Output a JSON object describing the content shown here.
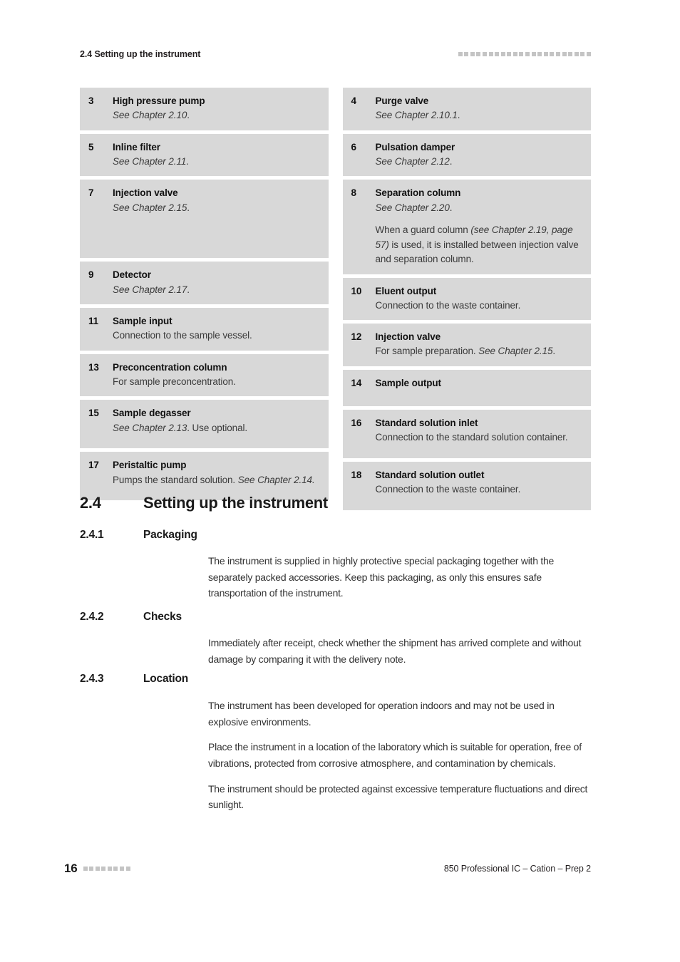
{
  "header": {
    "title": "2.4 Setting up the instrument",
    "rule_square_count": 22,
    "rule_color": "#c4c4c4"
  },
  "component_table": {
    "background_color": "#d8d8d8",
    "left_column": [
      {
        "number": "3",
        "title": "High pressure pump",
        "lines": [
          [
            {
              "text": "See Chapter 2.10",
              "style": "italic"
            },
            {
              "text": ".",
              "style": "normal"
            }
          ]
        ]
      },
      {
        "number": "5",
        "title": "Inline filter",
        "lines": [
          [
            {
              "text": "See Chapter 2.11",
              "style": "italic"
            },
            {
              "text": ".",
              "style": "normal"
            }
          ]
        ]
      },
      {
        "number": "7",
        "title": "Injection valve",
        "lines": [
          [
            {
              "text": "See Chapter 2.15",
              "style": "italic"
            },
            {
              "text": ".",
              "style": "normal"
            }
          ]
        ]
      },
      {
        "number": "9",
        "title": "Detector",
        "lines": [
          [
            {
              "text": "See Chapter 2.17",
              "style": "italic"
            },
            {
              "text": ".",
              "style": "normal"
            }
          ]
        ]
      },
      {
        "number": "11",
        "title": "Sample input",
        "lines": [
          [
            {
              "text": "Connection to the sample vessel.",
              "style": "normal"
            }
          ]
        ]
      },
      {
        "number": "13",
        "title": "Preconcentration column",
        "lines": [
          [
            {
              "text": "For sample preconcentration.",
              "style": "normal"
            }
          ]
        ]
      },
      {
        "number": "15",
        "title": "Sample degasser",
        "lines": [
          [
            {
              "text": "See Chapter 2.13",
              "style": "italic"
            },
            {
              "text": ". Use optional.",
              "style": "normal"
            }
          ]
        ]
      },
      {
        "number": "17",
        "title": "Peristaltic pump",
        "lines": [
          [
            {
              "text": "Pumps the standard solution. ",
              "style": "normal"
            },
            {
              "text": "See Chapter 2.14.",
              "style": "italic"
            }
          ]
        ]
      }
    ],
    "right_column": [
      {
        "number": "4",
        "title": "Purge valve",
        "lines": [
          [
            {
              "text": "See Chapter 2.10.1",
              "style": "italic"
            },
            {
              "text": ".",
              "style": "normal"
            }
          ]
        ]
      },
      {
        "number": "6",
        "title": "Pulsation damper",
        "lines": [
          [
            {
              "text": "See Chapter 2.12",
              "style": "italic"
            },
            {
              "text": ".",
              "style": "normal"
            }
          ]
        ]
      },
      {
        "number": "8",
        "title": "Separation column",
        "lines": [
          [
            {
              "text": "See Chapter 2.20",
              "style": "italic"
            },
            {
              "text": ".",
              "style": "normal"
            }
          ],
          [
            {
              "text": "When a guard column ",
              "style": "normal"
            },
            {
              "text": "(see Chapter 2.19, page 57)",
              "style": "italic"
            },
            {
              "text": " is used, it is installed between injection valve and separation column.",
              "style": "normal"
            }
          ]
        ]
      },
      {
        "number": "10",
        "title": "Eluent output",
        "lines": [
          [
            {
              "text": "Connection to the waste container.",
              "style": "normal"
            }
          ]
        ]
      },
      {
        "number": "12",
        "title": "Injection valve",
        "lines": [
          [
            {
              "text": "For sample preparation. ",
              "style": "normal"
            },
            {
              "text": "See Chapter 2.15",
              "style": "italic"
            },
            {
              "text": ".",
              "style": "normal"
            }
          ]
        ]
      },
      {
        "number": "14",
        "title": "Sample output",
        "lines": []
      },
      {
        "number": "16",
        "title": "Standard solution inlet",
        "lines": [
          [
            {
              "text": "Connection to the standard solution container.",
              "style": "normal"
            }
          ]
        ]
      },
      {
        "number": "18",
        "title": "Standard solution outlet",
        "lines": [
          [
            {
              "text": "Connection to the waste container.",
              "style": "normal"
            }
          ]
        ]
      }
    ]
  },
  "section": {
    "number": "2.4",
    "title": "Setting up the instrument",
    "subsections": [
      {
        "number": "2.4.1",
        "title": "Packaging",
        "paragraphs": [
          "The instrument is supplied in highly protective special packaging together with the separately packed accessories. Keep this packaging, as only this ensures safe transportation of the instrument."
        ]
      },
      {
        "number": "2.4.2",
        "title": "Checks",
        "paragraphs": [
          "Immediately after receipt, check whether the shipment has arrived complete and without damage by comparing it with the delivery note."
        ]
      },
      {
        "number": "2.4.3",
        "title": "Location",
        "paragraphs": [
          "The instrument has been developed for operation indoors and may not be used in explosive environments.",
          "Place the instrument in a location of the laboratory which is suitable for operation, free of vibrations, protected from corrosive atmosphere, and contamination by chemicals.",
          "The instrument should be protected against excessive temperature fluctuations and direct sunlight."
        ]
      }
    ]
  },
  "footer": {
    "page_number": "16",
    "rule_square_count": 8,
    "document_title": "850 Professional IC – Cation – Prep 2"
  }
}
